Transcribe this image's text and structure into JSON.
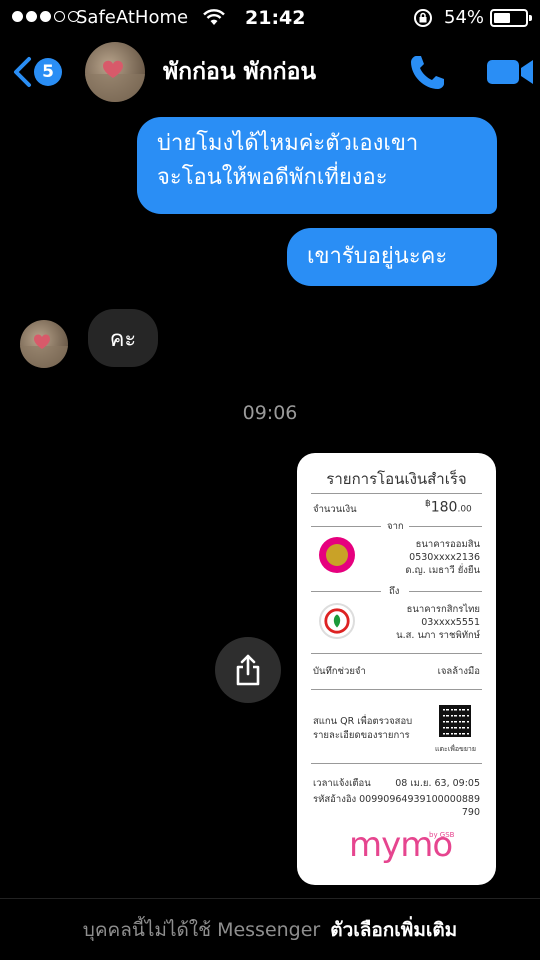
{
  "status_bar": {
    "carrier": "SafeAtHome",
    "time": "21:42",
    "battery": "54%",
    "battery_level": 0.54,
    "signal_bars": 3,
    "signal_total": 5
  },
  "nav": {
    "back_count": "5",
    "contact_name": "พักก่อน พักก่อน",
    "icons": [
      "back-chevron-icon",
      "phone-icon",
      "video-camera-icon"
    ],
    "accent": "#2a8ef5"
  },
  "messages": {
    "out_1": "บ่ายโมงได้ไหมค่ะตัวเองเขาจะโอนให้พอดีพักเที่ยงอะ",
    "out_1_line1": "บ่ายโมงได้ไหมค่ะตัวเองเขา",
    "out_1_line2": "จะโอนให้พอดีพักเที่ยงอะ",
    "out_2": "เขารับอยู่นะคะ",
    "in_1": "คะ",
    "timestamp": "09:06"
  },
  "receipt": {
    "title": "รายการโอนเงินสำเร็จ",
    "amount_label": "จำนวนเงิน",
    "amount_currency": "฿",
    "amount_value": "180",
    "amount_decimals": ".00",
    "from_label": "จาก",
    "from_bank": "ธนาคารออมสิน",
    "from_account": "0530xxxx2136",
    "from_name": "ด.ญ. เมธาวี ยั่งยืน",
    "to_label": "ถึง",
    "to_bank": "ธนาคารกสิกรไทย",
    "to_account": "03xxxx5551",
    "to_name": "น.ส. นภา ราชพิทักษ์",
    "memo_label": "บันทึกช่วยจำ",
    "memo_value": "เจลล้างมือ",
    "qr_line1": "สแกน QR เพื่อตรวจสอบ",
    "qr_line2": "รายละเอียดของรายการ",
    "qr_caption": "แตะเพื่อขยาย",
    "time_label": "เวลาแจ้งเตือน",
    "time_value": "08 เม.ย. 63, 09:05",
    "ref_label": "รหัสอ้างอิง",
    "ref_value_1": "00990964939100000889",
    "ref_value_2": "790",
    "brand": "mymo",
    "brand_tag": "by GSB",
    "brand_color": "#e6458f"
  },
  "share": {
    "icon": "share-icon"
  },
  "footer": {
    "notice": "บุคคลนี้ไม่ได้ใช้ Messenger",
    "more_options": "ตัวเลือกเพิ่มเติม"
  }
}
